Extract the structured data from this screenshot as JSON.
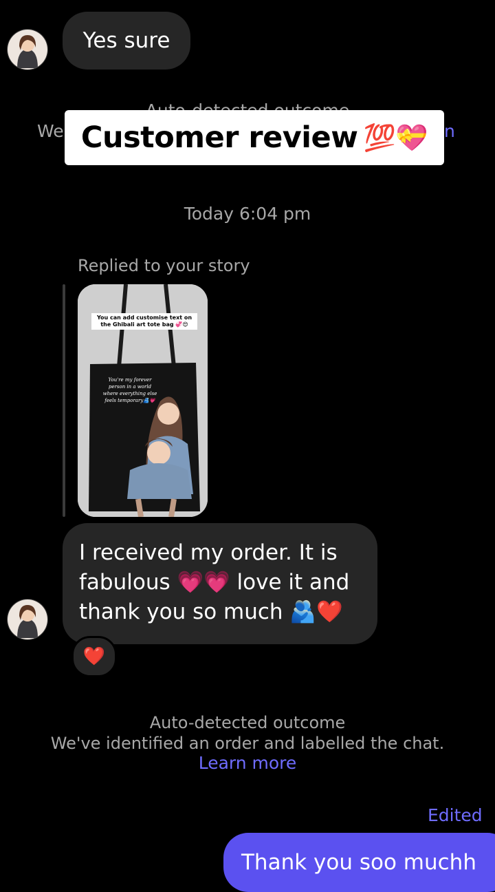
{
  "thread": {
    "msg1": "Yes sure",
    "partial_outcome_title": "Auto-detected outcome",
    "partial_outcome_left": "We",
    "partial_outcome_right": "n",
    "banner": "Customer review",
    "banner_emoji": "💯💝",
    "timestamp": "Today 6:04 pm",
    "replied_label": "Replied to your story",
    "story": {
      "caption": "You can add customise text on the Ghibali art tote bag 💞😍",
      "bag_text": "You're my forever person in a world where everything else feels temporary🫂💗"
    },
    "msg2": "I received my order. It is fabulous 💗💗 love it and thank you so much 🫂❤️",
    "reaction": "❤️",
    "outcome": {
      "title": "Auto-detected outcome",
      "body": "We've identified an order and labelled the chat.",
      "link": "Learn more"
    },
    "edited": "Edited",
    "msg3": "Thank you soo muchh"
  },
  "colors": {
    "background": "#000000",
    "incoming_bubble": "#262626",
    "outgoing_bubble": "#5b51f0",
    "link": "#6f6cff"
  }
}
